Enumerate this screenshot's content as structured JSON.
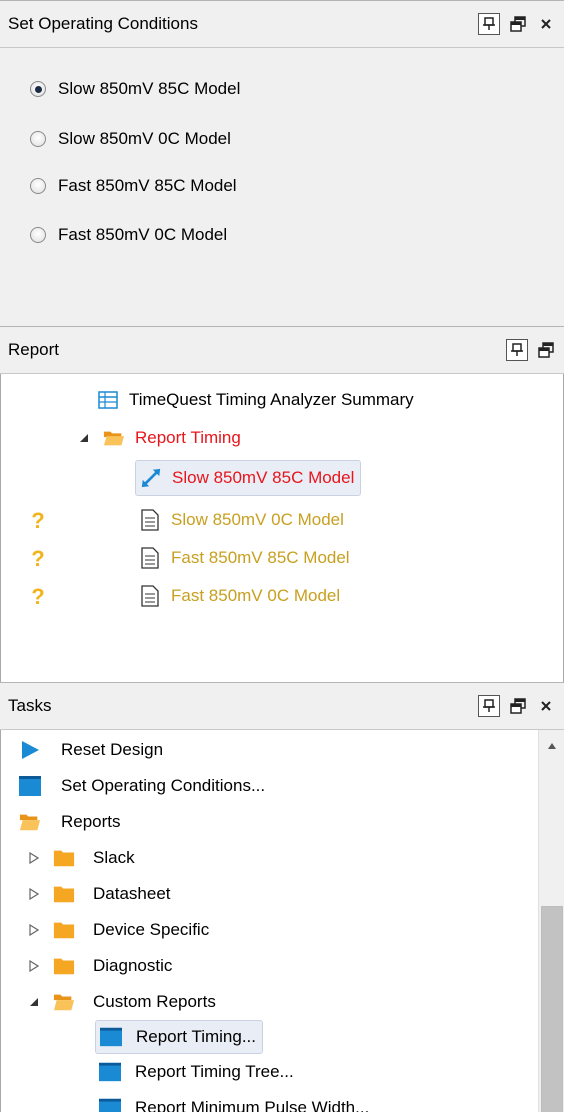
{
  "op_panel": {
    "title": "Set Operating Conditions",
    "icons": [
      "pin-icon",
      "float-window-icon",
      "close-icon"
    ],
    "options": [
      {
        "label": "Slow 850mV 85C Model",
        "checked": true
      },
      {
        "label": "Slow 850mV 0C Model",
        "checked": false
      },
      {
        "label": "Fast 850mV 85C Model",
        "checked": false
      },
      {
        "label": "Fast 850mV 0C Model",
        "checked": false
      }
    ]
  },
  "report_panel": {
    "title": "Report",
    "icons": [
      "pin-icon",
      "float-window-icon"
    ],
    "tree": {
      "summary": "TimeQuest Timing Analyzer Summary",
      "folder": "Report Timing",
      "items": [
        {
          "label": "Slow 850mV 85C Model",
          "status": "selected",
          "color": "#e8151b"
        },
        {
          "label": "Slow 850mV 0C Model",
          "status": "pending",
          "color": "#c8a020"
        },
        {
          "label": "Fast 850mV 85C Model",
          "status": "pending",
          "color": "#c8a020"
        },
        {
          "label": "Fast 850mV 0C Model",
          "status": "pending",
          "color": "#c8a020"
        }
      ],
      "pending_mark": "?"
    }
  },
  "tasks_panel": {
    "title": "Tasks",
    "icons": [
      "pin-icon",
      "float-window-icon",
      "close-icon"
    ],
    "items": {
      "reset": "Reset Design",
      "set_op": "Set Operating Conditions...",
      "reports": "Reports",
      "slack": "Slack",
      "datasheet": "Datasheet",
      "device_specific": "Device Specific",
      "diagnostic": "Diagnostic",
      "custom_reports": "Custom Reports",
      "report_timing": "Report Timing...",
      "report_timing_tree": "Report Timing Tree...",
      "report_min_pulse": "Report Minimum Pulse Width..."
    }
  },
  "colors": {
    "panel_bg": "#f0f0f0",
    "report_red": "#e8151b",
    "pending_gold": "#c8a020",
    "question_orange": "#f2b41e",
    "folder_orange": "#f5a623",
    "task_blue": "#1a8ad4"
  }
}
